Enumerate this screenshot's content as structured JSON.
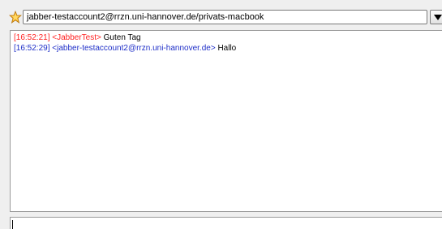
{
  "toolbar": {
    "status_icon": "star-icon",
    "recipient": "jabber-testaccount2@rrzn.uni-hannover.de/privats-macbook",
    "dropdown_icon": "triangle-down-icon"
  },
  "messages": [
    {
      "time": "[16:52:21]",
      "nick": "<JabberTest>",
      "text": "Guten Tag",
      "color": "#ff1f1f"
    },
    {
      "time": "[16:52:29]",
      "nick": "<jabber-testaccount2@rrzn.uni-hannover.de>",
      "text": "Hallo",
      "color": "#1f2fc8"
    }
  ],
  "input": {
    "value": ""
  }
}
